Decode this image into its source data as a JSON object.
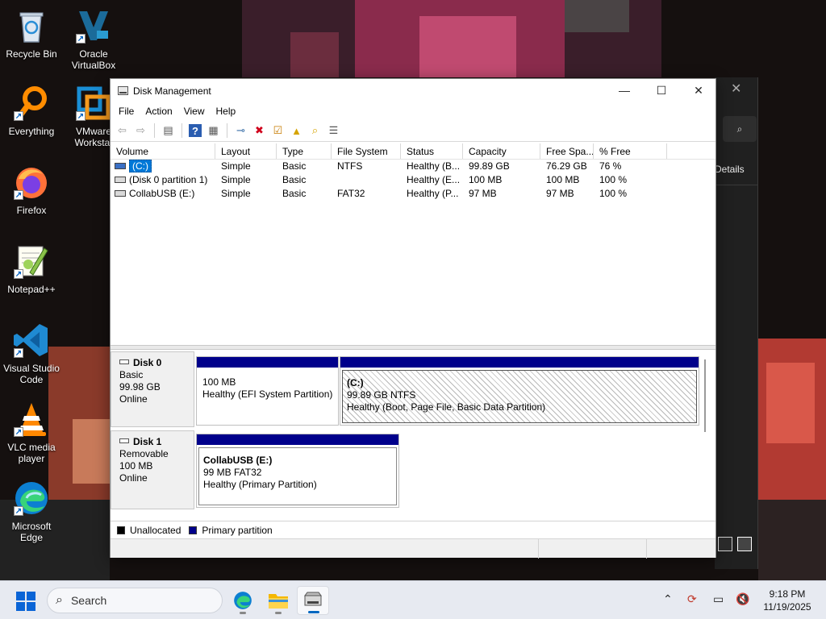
{
  "desktop": {
    "icons": [
      {
        "label": "Recycle Bin",
        "icon": "recycle-bin-icon"
      },
      {
        "label": "Oracle VirtualBox",
        "icon": "virtualbox-icon"
      },
      {
        "label": "Everything",
        "icon": "everything-search-icon"
      },
      {
        "label": "VMware Workstat",
        "icon": "vmware-icon"
      },
      {
        "label": "Firefox",
        "icon": "firefox-icon"
      },
      {
        "label": "Notepad++",
        "icon": "notepadpp-icon"
      },
      {
        "label": "Visual Studio Code",
        "icon": "vscode-icon"
      },
      {
        "label": "VLC media player",
        "icon": "vlc-icon"
      },
      {
        "label": "Microsoft Edge",
        "icon": "edge-icon"
      }
    ],
    "shortcut_glyph": "↗"
  },
  "back_window": {
    "close_glyph": "✕",
    "search_glyph": "⌕",
    "details_label": "Details"
  },
  "window": {
    "title": "Disk Management",
    "controls": {
      "minimize": "—",
      "maximize": "☐",
      "close": "✕"
    },
    "menu": [
      "File",
      "Action",
      "View",
      "Help"
    ],
    "toolbar": [
      {
        "icon": "back-arrow-icon",
        "glyph": "⇦",
        "color": "#9a9a9a"
      },
      {
        "icon": "forward-arrow-icon",
        "glyph": "⇨",
        "color": "#9a9a9a"
      },
      {
        "icon": "show-hide-tree-icon",
        "glyph": "▤",
        "color": "#555555"
      },
      {
        "icon": "help-icon",
        "glyph": "?",
        "color": "#2a5db0"
      },
      {
        "icon": "properties-icon",
        "glyph": "▦",
        "color": "#555555"
      },
      {
        "icon": "connect-icon",
        "glyph": "⊸",
        "color": "#3a6fa8"
      },
      {
        "icon": "delete-icon",
        "glyph": "✖",
        "color": "#d0021b"
      },
      {
        "icon": "check-icon",
        "glyph": "☑",
        "color": "#c77b00"
      },
      {
        "icon": "folder-up-icon",
        "glyph": "▲",
        "color": "#d6a400"
      },
      {
        "icon": "folder-search-icon",
        "glyph": "⌕",
        "color": "#d6a400"
      },
      {
        "icon": "list-view-icon",
        "glyph": "☰",
        "color": "#555555"
      }
    ]
  },
  "volumes": {
    "columns": [
      "Volume",
      "Layout",
      "Type",
      "File System",
      "Status",
      "Capacity",
      "Free Spa...",
      "% Free"
    ],
    "rows": [
      {
        "volume": "(C:)",
        "layout": "Simple",
        "type": "Basic",
        "fs": "NTFS",
        "status": "Healthy (B...",
        "capacity": "99.89 GB",
        "free": "76.29 GB",
        "pct": "76 %",
        "selected": true
      },
      {
        "volume": "(Disk 0 partition 1)",
        "layout": "Simple",
        "type": "Basic",
        "fs": "",
        "status": "Healthy (E...",
        "capacity": "100 MB",
        "free": "100 MB",
        "pct": "100 %",
        "selected": false
      },
      {
        "volume": "CollabUSB (E:)",
        "layout": "Simple",
        "type": "Basic",
        "fs": "FAT32",
        "status": "Healthy (P...",
        "capacity": "97 MB",
        "free": "97 MB",
        "pct": "100 %",
        "selected": false
      }
    ]
  },
  "disks": [
    {
      "name": "Disk 0",
      "kind": "Basic",
      "size": "99.98 GB",
      "state": "Online",
      "partitions": [
        {
          "title": "",
          "line1": "100 MB",
          "line2": "Healthy (EFI System Partition)",
          "hatched": false
        },
        {
          "title": "(C:)",
          "line1": "99.89 GB NTFS",
          "line2": "Healthy (Boot, Page File, Basic Data Partition)",
          "hatched": true
        }
      ]
    },
    {
      "name": "Disk 1",
      "kind": "Removable",
      "size": "100 MB",
      "state": "Online",
      "partitions": [
        {
          "title": "CollabUSB  (E:)",
          "line1": "99 MB FAT32",
          "line2": "Healthy (Primary Partition)",
          "hatched": false
        }
      ]
    }
  ],
  "legend": [
    {
      "label": "Unallocated",
      "color": "#000000"
    },
    {
      "label": "Primary partition",
      "color": "#00008b"
    }
  ],
  "taskbar": {
    "search_placeholder": "Search",
    "apps": [
      "edge-icon",
      "file-explorer-icon",
      "disk-management-icon"
    ],
    "tray": [
      "chevron-up-icon",
      "sync-icon",
      "network-icon",
      "volume-muted-icon"
    ],
    "time": "9:18 PM",
    "date": "11/19/2025"
  }
}
